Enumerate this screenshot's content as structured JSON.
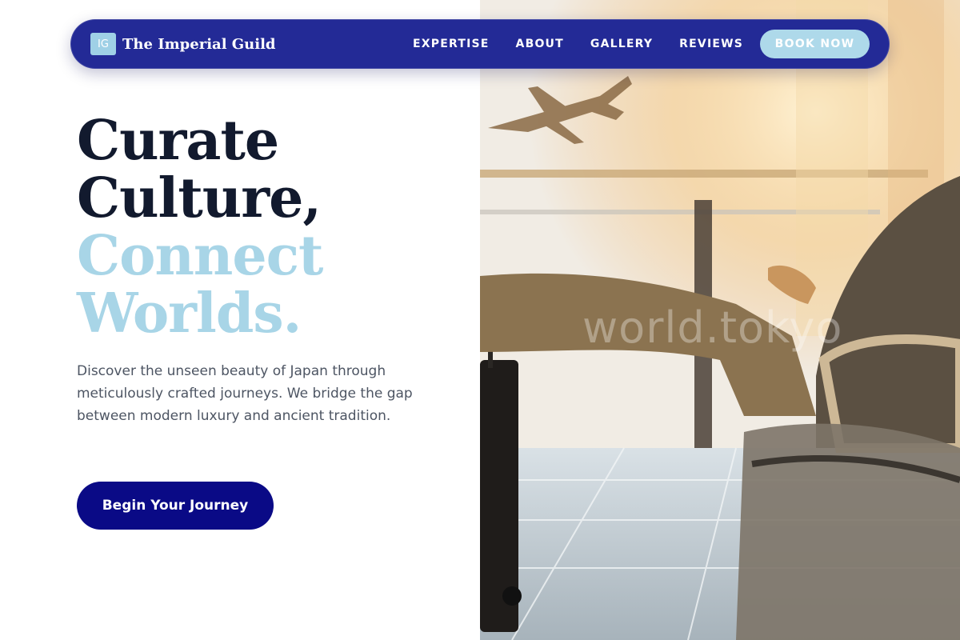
{
  "nav": {
    "logo_text": "IG",
    "brand_name": "The Imperial Guild",
    "links": [
      {
        "label": "EXPERTISE"
      },
      {
        "label": "ABOUT"
      },
      {
        "label": "GALLERY"
      },
      {
        "label": "REVIEWS"
      }
    ],
    "cta_label": "BOOK NOW"
  },
  "hero": {
    "title_lines_dark": [
      "Curate",
      "Culture,"
    ],
    "title_lines_light": [
      "Connect",
      "Worlds."
    ],
    "description": "Discover the unseen beauty of Japan through meticulously crafted journeys. We bridge the gap between modern luxury and ancient tradition.",
    "cta_label": "Begin Your Journey"
  },
  "photo": {
    "watermark": "world.tokyo"
  },
  "colors": {
    "nav_bg": "#232a96",
    "accent_light_blue": "#a8d5e7",
    "title_dark": "#121a2e",
    "cta_bg": "#0a0a86"
  }
}
